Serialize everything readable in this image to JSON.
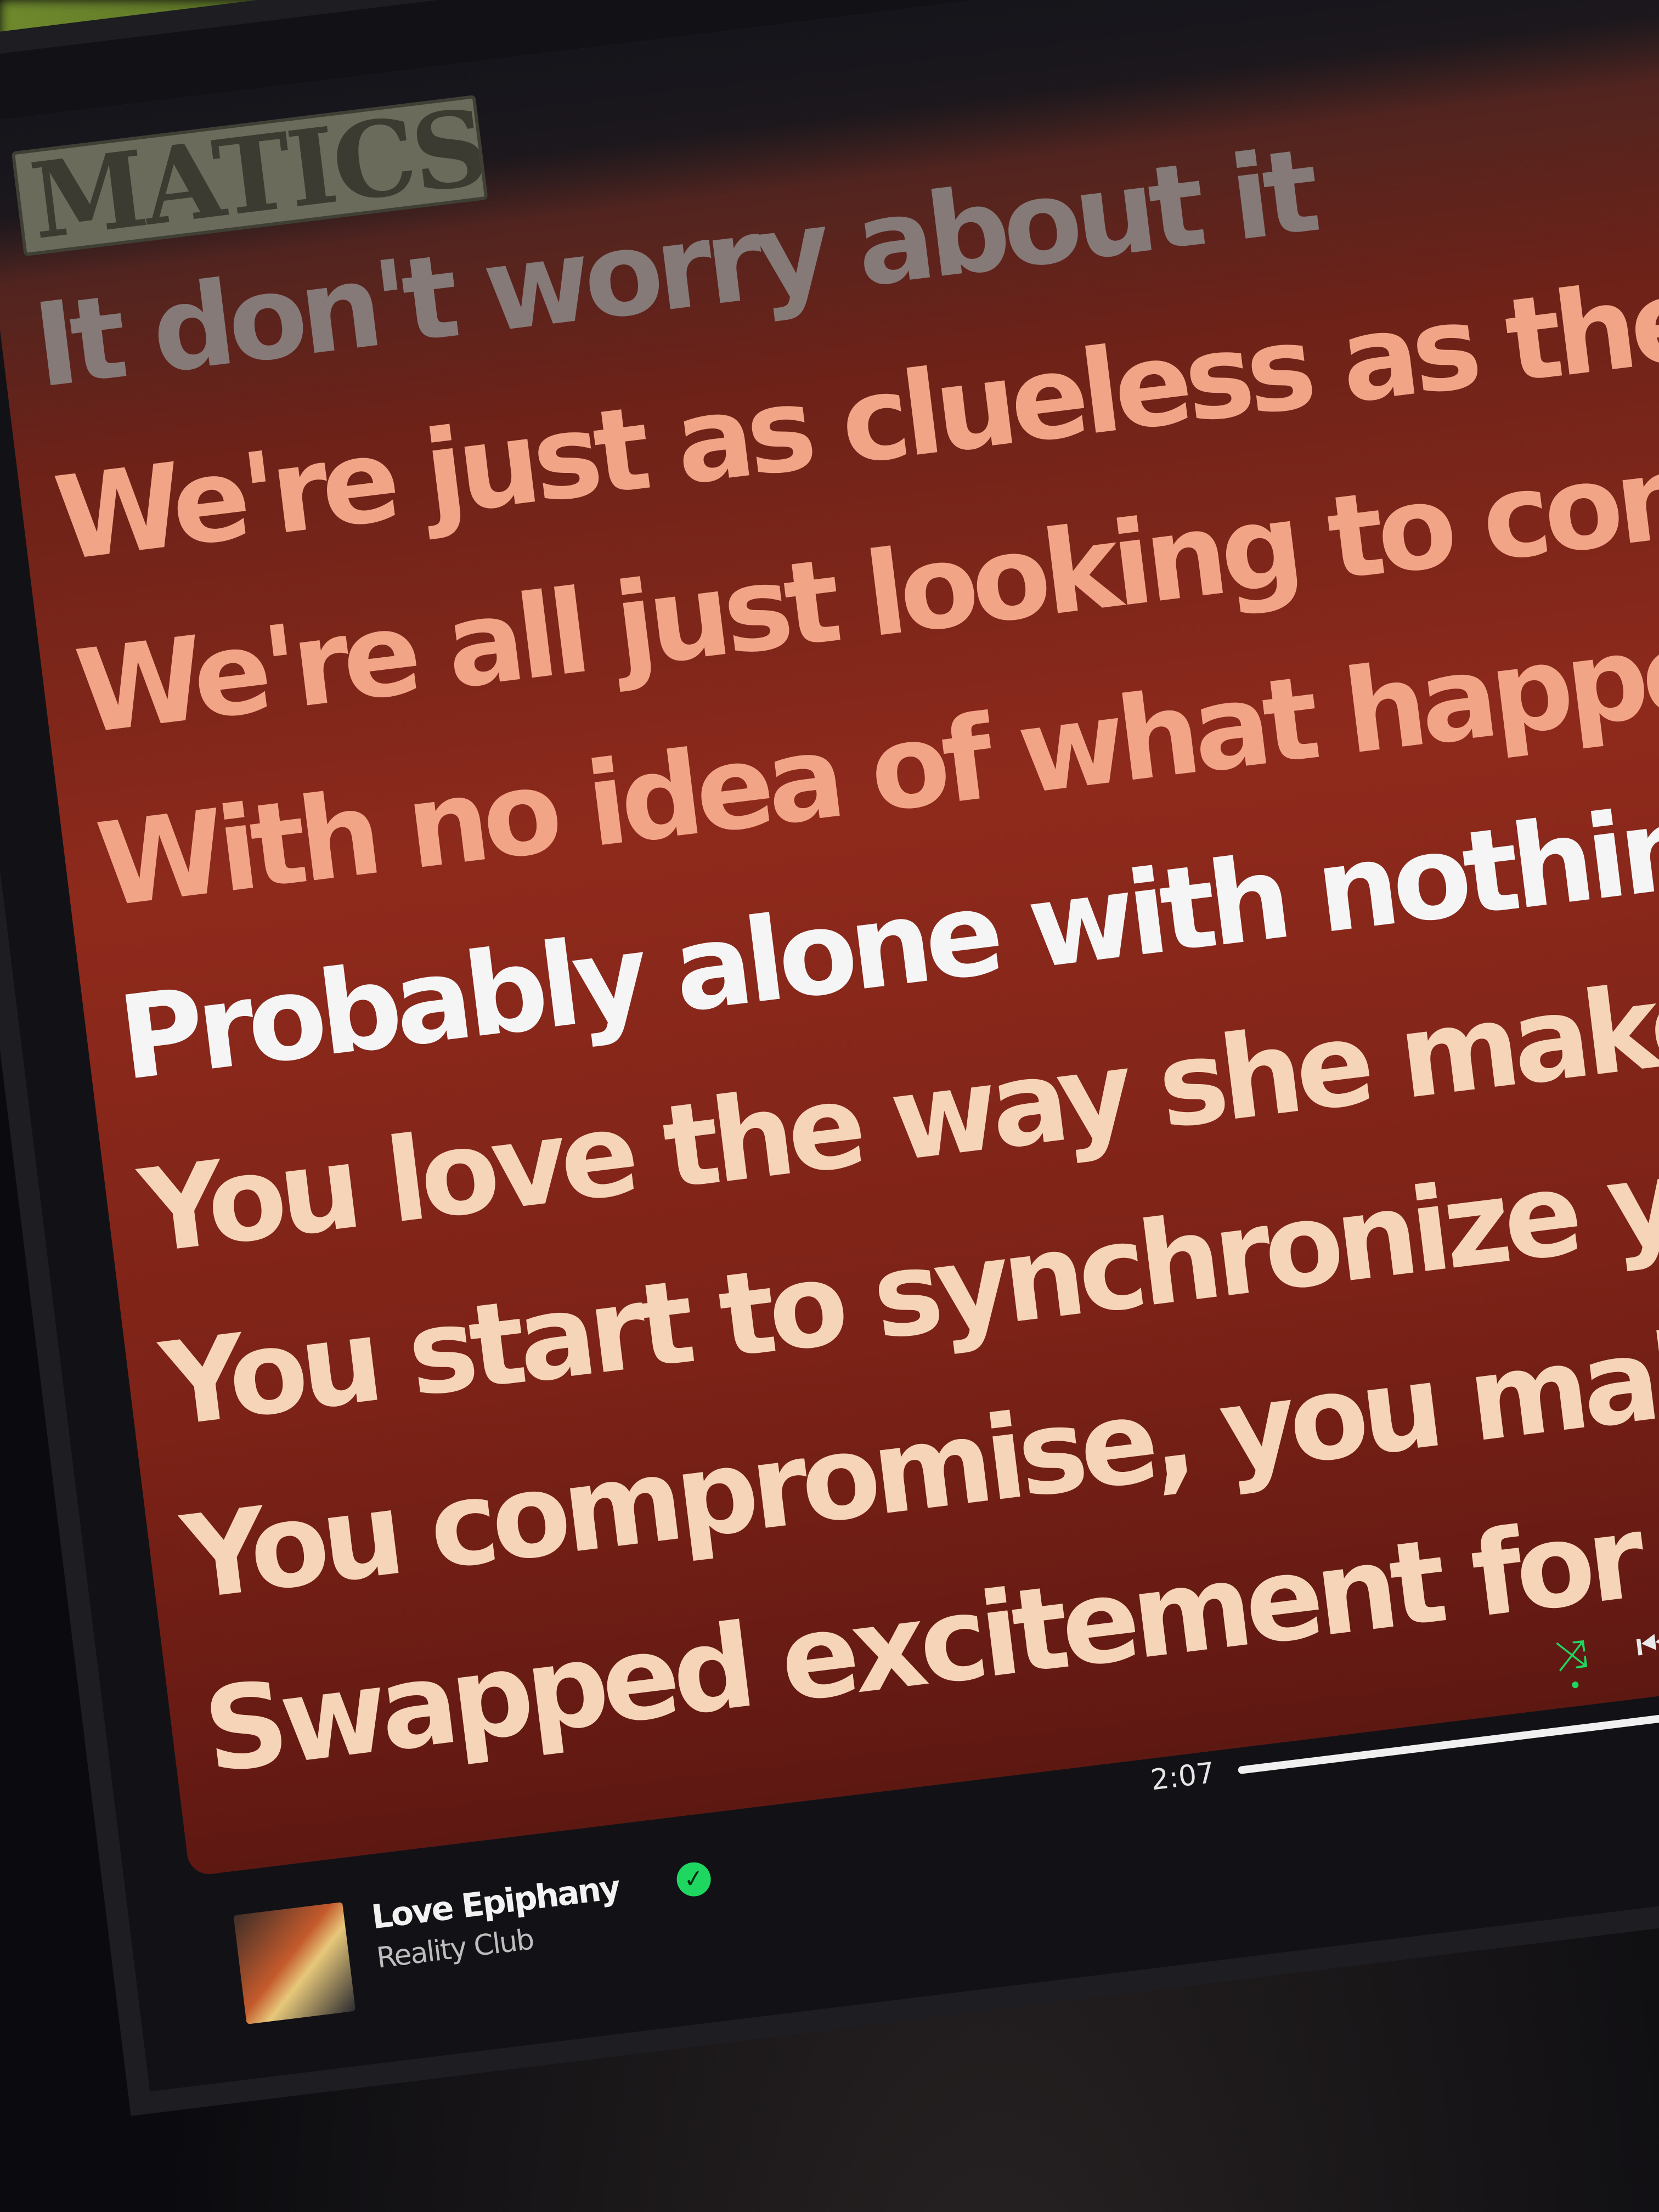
{
  "header": {
    "album_art_text": "MATICS",
    "icons": [
      "radio-icon",
      "lyrics-view-icon"
    ]
  },
  "lyrics": {
    "lines": [
      {
        "text": "It don't worry about it",
        "state": "dim"
      },
      {
        "text": "We're just as clueless as the rest",
        "state": "past"
      },
      {
        "text": "We're all just looking to connect",
        "state": "past"
      },
      {
        "text": "With no idea of what happens next",
        "state": "past"
      },
      {
        "text": "Probably alone with nothing left",
        "state": "active"
      },
      {
        "text": "You love the way she makes you feel",
        "state": "upcoming"
      },
      {
        "text": "You start to synchronize your meals",
        "state": "upcoming"
      },
      {
        "text": "You compromise, you make some de",
        "state": "upcoming"
      },
      {
        "text": "Swapped excitement for some com",
        "state": "upcoming"
      }
    ]
  },
  "player": {
    "track_title": "Love Epiphany",
    "artist": "Reality Club",
    "liked": true,
    "current_time": "2:07",
    "progress": 0.62,
    "shuffle_on": true,
    "controls": [
      "shuffle-icon",
      "previous-icon",
      "pause-icon"
    ]
  },
  "colors": {
    "accent": "#1ed760",
    "lyric_past": "#f2a487",
    "lyric_active": "#f5f5f5",
    "lyric_upcoming": "#f6d4b8",
    "panel": "#8e2a1c"
  }
}
